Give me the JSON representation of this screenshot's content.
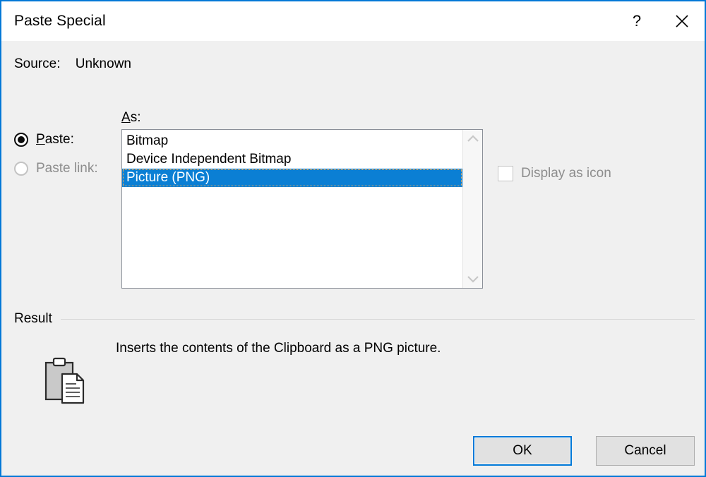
{
  "window": {
    "title": "Paste Special",
    "help_icon": "question-mark-icon",
    "close_icon": "close-icon",
    "accent_color": "#0078D7"
  },
  "source": {
    "label": "Source:",
    "value": "Unknown"
  },
  "paste_mode": {
    "options": [
      {
        "label": "Paste:",
        "accel": "P",
        "rest": "aste:",
        "selected": true,
        "disabled": false
      },
      {
        "label": "Paste link:",
        "accel": "",
        "rest": "Paste link:",
        "selected": false,
        "disabled": true
      }
    ]
  },
  "as_list": {
    "label_accel": "A",
    "label_rest": "s:",
    "items": [
      {
        "label": "Bitmap",
        "selected": false
      },
      {
        "label": "Device Independent Bitmap",
        "selected": false
      },
      {
        "label": "Picture (PNG)",
        "selected": true
      }
    ],
    "selection_color": "#0b7fd4",
    "scrollbar": {
      "up_icon": "chevron-up-icon",
      "down_icon": "chevron-down-icon"
    }
  },
  "display_as_icon": {
    "label": "Display as icon",
    "checked": false,
    "disabled": true
  },
  "result": {
    "title": "Result",
    "icon": "clipboard-paste-icon",
    "description": "Inserts the contents of the Clipboard as a PNG picture."
  },
  "footer": {
    "ok_label": "OK",
    "cancel_label": "Cancel"
  }
}
